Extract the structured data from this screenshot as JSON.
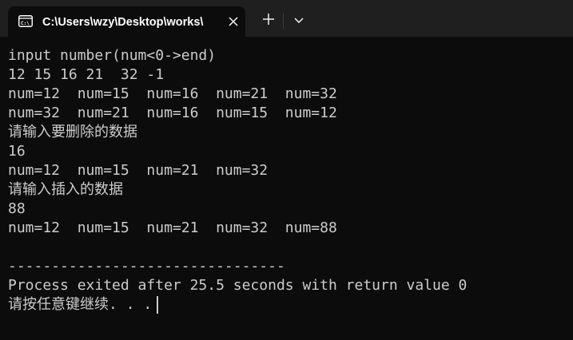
{
  "tab": {
    "title": "C:\\Users\\wzy\\Desktop\\works\\",
    "icon": "terminal-icon"
  },
  "titlebar": {
    "close_icon": "close-icon",
    "new_tab_icon": "plus-icon",
    "dropdown_icon": "chevron-down-icon"
  },
  "console": {
    "lines": [
      "input number(num<0->end)",
      "12 15 16 21  32 -1",
      "num=12  num=15  num=16  num=21  num=32",
      "num=32  num=21  num=16  num=15  num=12",
      "请输入要删除的数据",
      "16",
      "num=12  num=15  num=21  num=32",
      "请输入插入的数据",
      "88",
      "num=12  num=15  num=21  num=32  num=88",
      "",
      "--------------------------------",
      "Process exited after 25.5 seconds with return value 0",
      "请按任意键继续. . ."
    ]
  },
  "colors": {
    "background": "#0c0c0c",
    "titlebar": "#1f1f1f",
    "text": "#cccccc"
  }
}
